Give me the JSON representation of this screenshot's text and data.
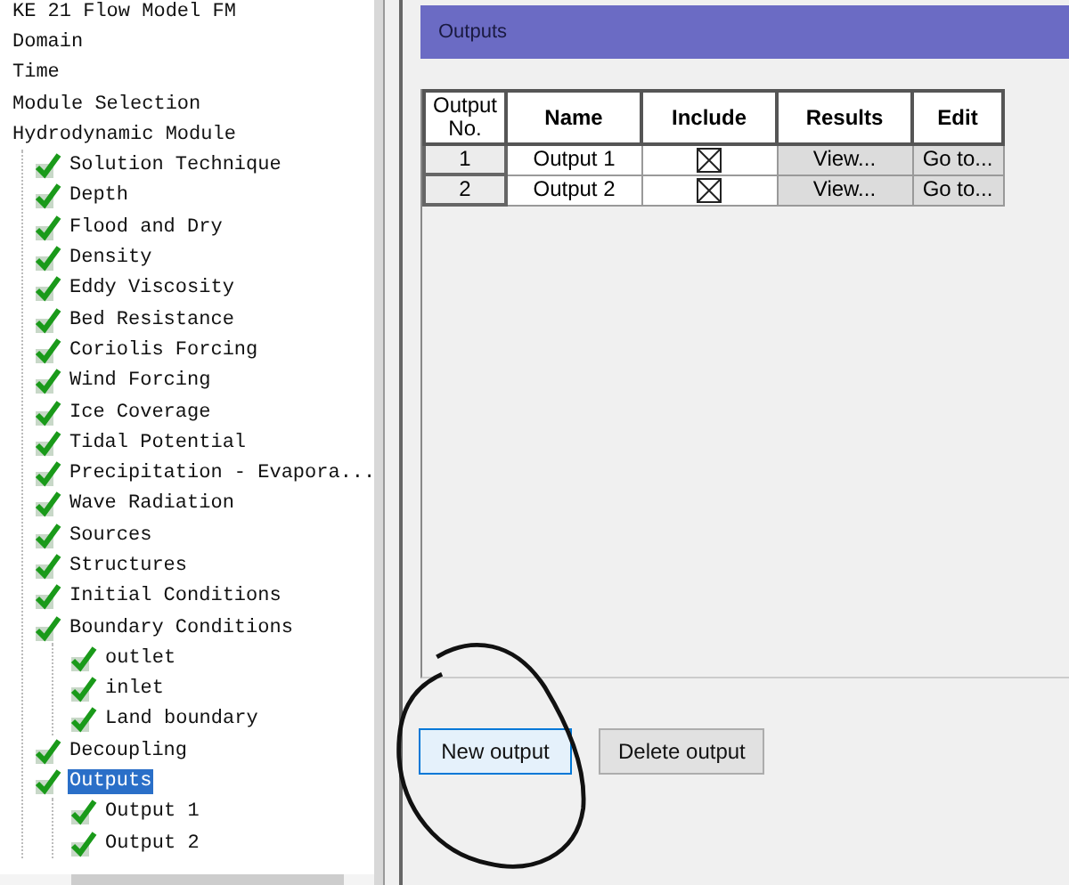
{
  "tree": [
    {
      "label": "KE 21 Flow Model FM",
      "checked": false,
      "selected": false
    },
    {
      "label": "Domain",
      "checked": false,
      "selected": false
    },
    {
      "label": "Time",
      "checked": false,
      "selected": false
    },
    {
      "label": "Module Selection",
      "checked": false,
      "selected": false
    },
    {
      "label": "Hydrodynamic Module",
      "checked": false,
      "selected": false,
      "expanded": true,
      "children": [
        {
          "label": "Solution Technique",
          "checked": true,
          "selected": false
        },
        {
          "label": "Depth",
          "checked": true,
          "selected": false
        },
        {
          "label": "Flood and Dry",
          "checked": true,
          "selected": false
        },
        {
          "label": "Density",
          "checked": true,
          "selected": false
        },
        {
          "label": "Eddy Viscosity",
          "checked": true,
          "selected": false
        },
        {
          "label": "Bed Resistance",
          "checked": true,
          "selected": false
        },
        {
          "label": "Coriolis Forcing",
          "checked": true,
          "selected": false
        },
        {
          "label": "Wind Forcing",
          "checked": true,
          "selected": false
        },
        {
          "label": "Ice Coverage",
          "checked": true,
          "selected": false
        },
        {
          "label": "Tidal Potential",
          "checked": true,
          "selected": false
        },
        {
          "label": "Precipitation - Evapora...",
          "checked": true,
          "selected": false
        },
        {
          "label": "Wave Radiation",
          "checked": true,
          "selected": false
        },
        {
          "label": "Sources",
          "checked": true,
          "selected": false
        },
        {
          "label": "Structures",
          "checked": true,
          "selected": false
        },
        {
          "label": "Initial Conditions",
          "checked": true,
          "selected": false
        },
        {
          "label": "Boundary Conditions",
          "checked": true,
          "selected": false,
          "expanded": true,
          "children": [
            {
              "label": "outlet",
              "checked": true,
              "selected": false
            },
            {
              "label": "inlet",
              "checked": true,
              "selected": false
            },
            {
              "label": "Land boundary",
              "checked": true,
              "selected": false
            }
          ]
        },
        {
          "label": "Decoupling",
          "checked": true,
          "selected": false
        },
        {
          "label": "Outputs",
          "checked": true,
          "selected": true,
          "expanded": true,
          "children": [
            {
              "label": "Output 1",
              "checked": true,
              "selected": false
            },
            {
              "label": "Output 2",
              "checked": true,
              "selected": false
            }
          ]
        }
      ]
    }
  ],
  "panel": {
    "title": "Outputs"
  },
  "table": {
    "columns": [
      "Output No.",
      "Name",
      "Include",
      "Results",
      "Edit"
    ],
    "rows": [
      {
        "no": "1",
        "name": "Output 1",
        "include": true,
        "results": "View...",
        "edit": "Go to..."
      },
      {
        "no": "2",
        "name": "Output 2",
        "include": true,
        "results": "View...",
        "edit": "Go to..."
      }
    ]
  },
  "buttons": [
    {
      "label": "New output",
      "focused": true
    },
    {
      "label": "Delete output",
      "focused": false
    }
  ]
}
